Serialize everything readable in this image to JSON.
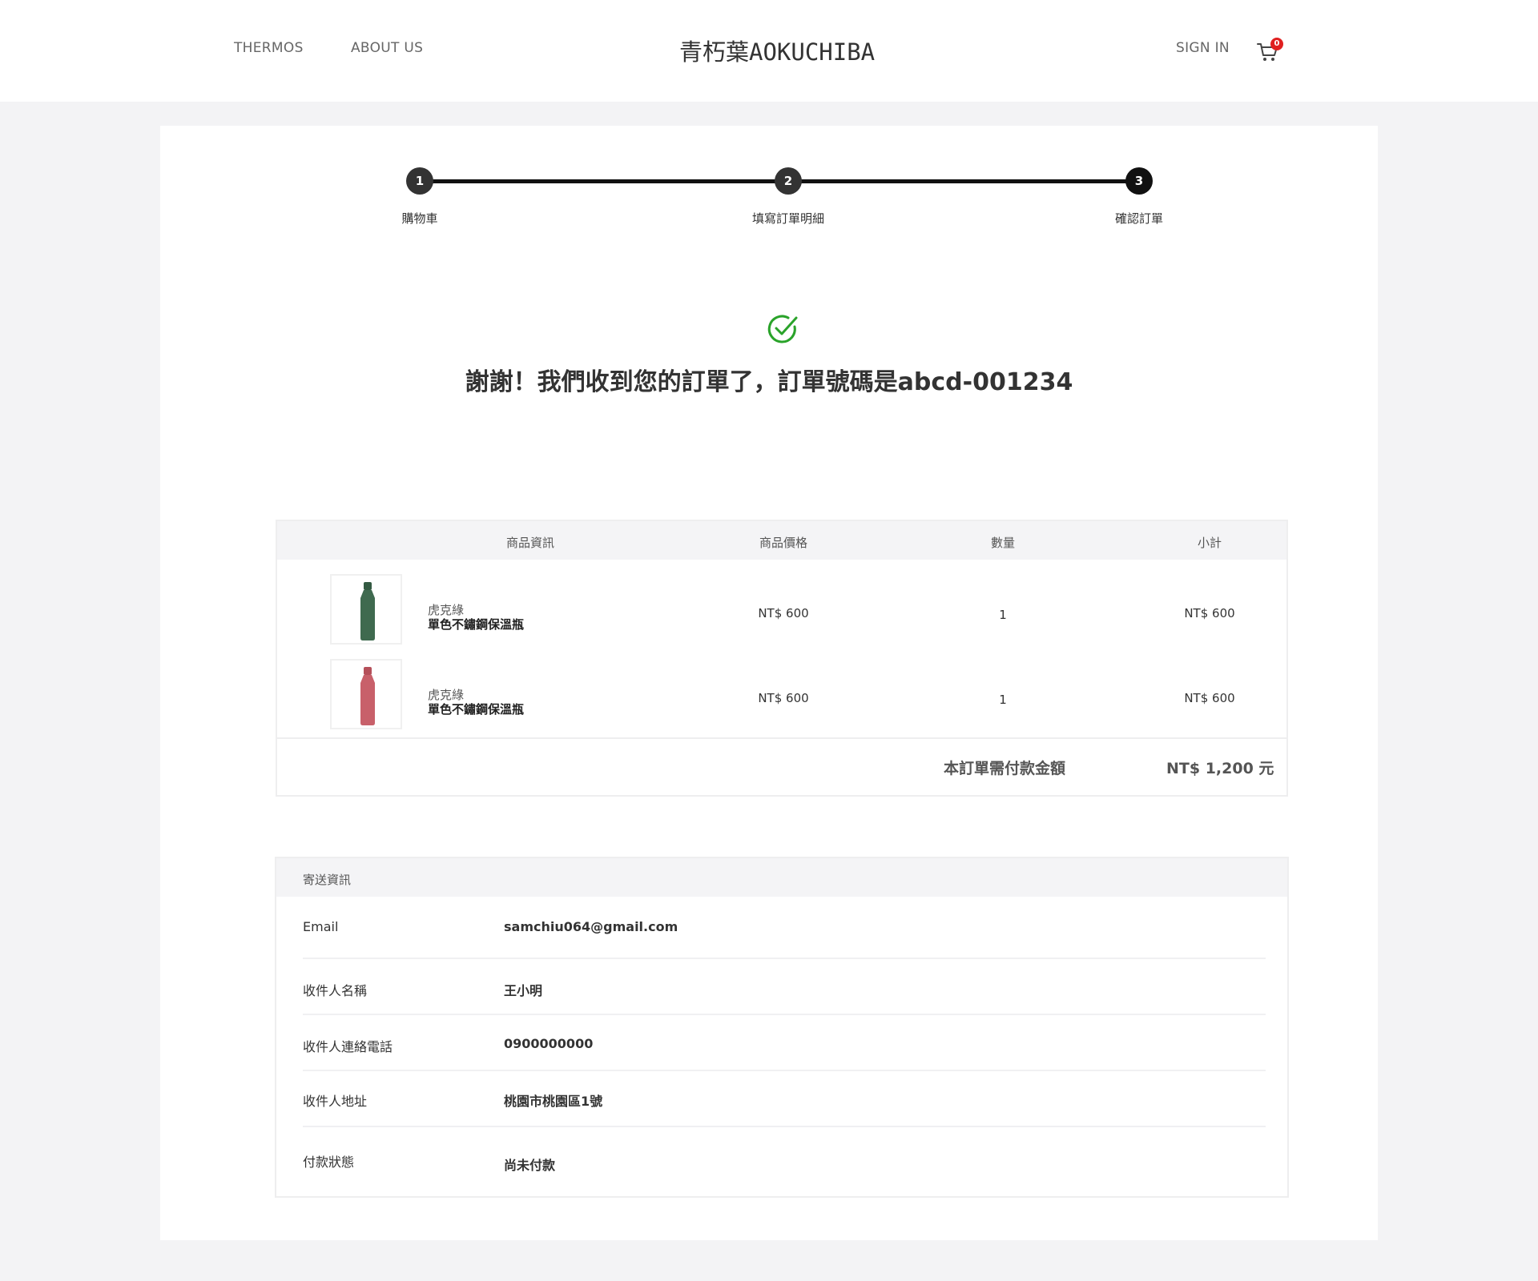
{
  "header": {
    "nav": [
      {
        "label": "THERMOS"
      },
      {
        "label": "ABOUT US"
      }
    ],
    "logo": "青朽葉AOKUCHIBA",
    "sign_in": "SIGN IN",
    "cart_count": "0"
  },
  "stepper": {
    "steps": [
      {
        "number": "1",
        "label": "購物車"
      },
      {
        "number": "2",
        "label": "填寫訂單明細"
      },
      {
        "number": "3",
        "label": "確認訂單"
      }
    ]
  },
  "confirmation": {
    "message": "謝謝！我們收到您的訂單了，訂單號碼是abcd-001234"
  },
  "order": {
    "columns": [
      "商品資訊",
      "商品價格",
      "數量",
      "小計"
    ],
    "items": [
      {
        "color": "虎克綠",
        "name": "單色不鏽鋼保溫瓶",
        "price": "NT$ 600",
        "quantity": "1",
        "subtotal": "NT$ 600",
        "bottle_color": "#3f6a4f"
      },
      {
        "color": "虎克綠",
        "name": "單色不鏽鋼保溫瓶",
        "price": "NT$ 600",
        "quantity": "1",
        "subtotal": "NT$ 600",
        "bottle_color": "#c8606a"
      }
    ],
    "total_label": "本訂單需付款金額",
    "total_value": "NT$  1,200 元"
  },
  "shipping": {
    "title": "寄送資訊",
    "fields": [
      {
        "label": "Email",
        "value": "samchiu064@gmail.com"
      },
      {
        "label": "收件人名稱",
        "value": "王小明"
      },
      {
        "label": "收件人連絡電話",
        "value": "0900000000"
      },
      {
        "label": "收件人地址",
        "value": "桃園市桃園區1號"
      },
      {
        "label": "付款狀態",
        "value": "尚未付款"
      }
    ]
  },
  "colors": {
    "success": "#2aa32a",
    "badge": "#e02020",
    "stepper": "#111111"
  }
}
